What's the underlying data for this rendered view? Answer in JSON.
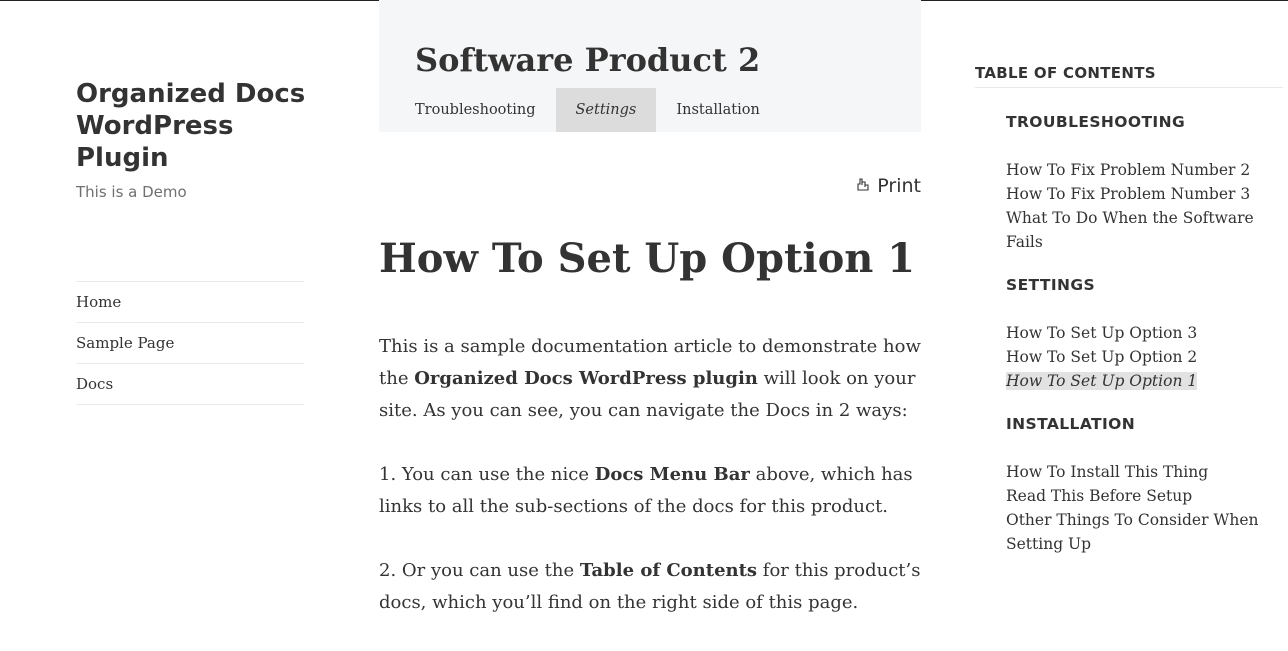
{
  "site": {
    "title": "Organized Docs WordPress Plugin",
    "tagline": "This is a Demo"
  },
  "left_nav": [
    {
      "label": "Home"
    },
    {
      "label": "Sample Page"
    },
    {
      "label": "Docs"
    }
  ],
  "docs_header": {
    "product_title": "Software Product 2",
    "tabs": [
      {
        "label": "Troubleshooting",
        "active": false
      },
      {
        "label": "Settings",
        "active": true
      },
      {
        "label": "Installation",
        "active": false
      }
    ]
  },
  "print": {
    "label": "Print",
    "icon": "print-icon"
  },
  "article": {
    "title": "How To Set Up Option 1",
    "p1": {
      "a": "This is a sample documentation article to demonstrate how the ",
      "b": "Organized Docs WordPress plugin",
      "c": " will look on your site. As you can see, you can navigate the Docs in 2 ways:"
    },
    "p2": {
      "a": "1. You can use the nice ",
      "b": "Docs Menu Bar",
      "c": " above, which has links to all the sub-sections of the docs for this product."
    },
    "p3": {
      "a": "2. Or you can use the ",
      "b": "Table of Contents",
      "c": " for this product’s docs, which you’ll find on the right side of this page."
    }
  },
  "toc": {
    "heading": "TABLE OF CONTENTS",
    "sections": [
      {
        "title": "TROUBLESHOOTING",
        "items": [
          "How To Fix Problem Number 2",
          "How To Fix Problem Number 3",
          "What To Do When the Software Fails"
        ]
      },
      {
        "title": "SETTINGS",
        "items": [
          "How To Set Up Option 3",
          "How To Set Up Option 2",
          "How To Set Up Option 1"
        ],
        "current": "How To Set Up Option 1"
      },
      {
        "title": "INSTALLATION",
        "items": [
          "How To Install This Thing",
          "Read This Before Setup",
          "Other Things To Consider When Setting Up"
        ]
      }
    ]
  }
}
